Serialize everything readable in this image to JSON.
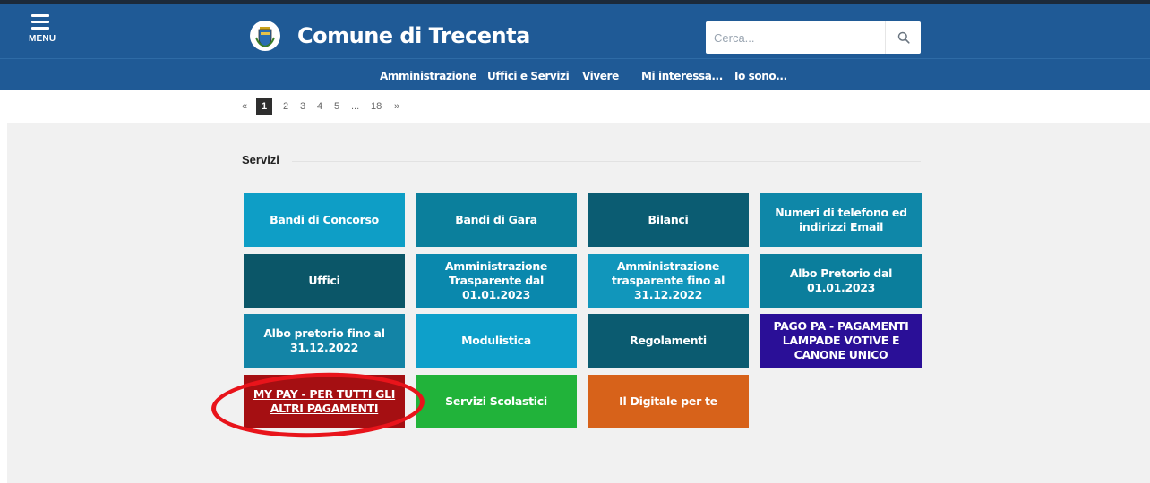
{
  "header": {
    "menu_label": "MENU",
    "title": "Comune di Trecenta",
    "search_placeholder": "Cerca..."
  },
  "nav": {
    "items": [
      "Amministrazione",
      "Uffici e Servizi",
      "Vivere",
      "Mi interessa...",
      "Io sono..."
    ]
  },
  "pagination": {
    "prev": "«",
    "current": "1",
    "pages": [
      "2",
      "3",
      "4",
      "5"
    ],
    "ellipsis": "...",
    "last": "18",
    "next": "»"
  },
  "section": {
    "title": "Servizi"
  },
  "tiles": [
    {
      "label": "Bandi di Concorso",
      "color": "#0e9ec6"
    },
    {
      "label": "Bandi di Gara",
      "color": "#0b7f9c"
    },
    {
      "label": "Bilanci",
      "color": "#0b5c72"
    },
    {
      "label": "Numeri di telefono ed indirizzi Email",
      "color": "#0f87a8"
    },
    {
      "label": "Uffici",
      "color": "#0b5668"
    },
    {
      "label": "Amministrazione Trasparente dal 01.01.2023",
      "color": "#0a88ad"
    },
    {
      "label": "Amministrazione trasparente fino al 31.12.2022",
      "color": "#1196bb"
    },
    {
      "label": "Albo Pretorio dal 01.01.2023",
      "color": "#0b7e9c"
    },
    {
      "label": "Albo pretorio fino al 31.12.2022",
      "color": "#1384a6"
    },
    {
      "label": "Modulistica",
      "color": "#0ea0ca"
    },
    {
      "label": "Regolamenti",
      "color": "#0b5b70"
    },
    {
      "label": "PAGO PA - PAGAMENTI LAMPADE VOTIVE E CANONE UNICO",
      "color": "#2a0f97"
    },
    {
      "label": "MY PAY - PER TUTTI GLI ALTRI PAGAMENTI",
      "color": "#a50f12"
    },
    {
      "label": "Servizi Scolastici",
      "color": "#21b33a"
    },
    {
      "label": "Il Digitale per te",
      "color": "#d7621a"
    }
  ],
  "colors": {
    "header": "#1f5a96",
    "annotation": "#e8141b"
  },
  "icons": {
    "menu": "hamburger-icon",
    "search": "search-icon",
    "crest": "coat-of-arms-logo"
  }
}
